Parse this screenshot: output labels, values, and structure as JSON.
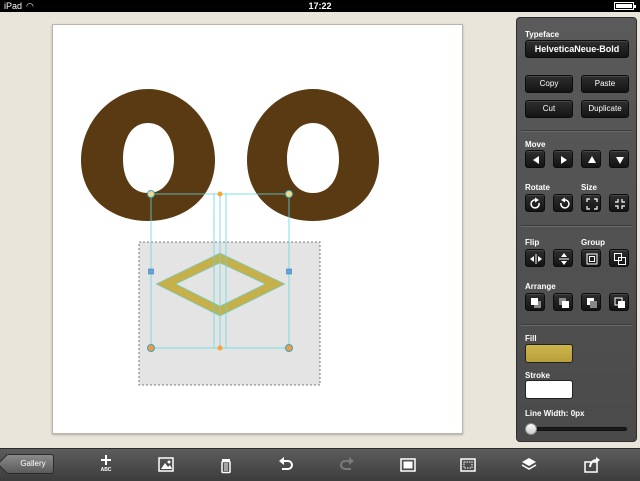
{
  "status_bar": {
    "carrier": "iPad",
    "time": "17:22"
  },
  "canvas": {
    "letters": [
      "O",
      "O"
    ],
    "letter_color": "#5a3a13",
    "shape_fill": "#c6b04c",
    "selection_color": "#5fd7e0"
  },
  "panel": {
    "typeface_label": "Typeface",
    "typeface_value": "HelveticaNeue-Bold",
    "copy": "Copy",
    "paste": "Paste",
    "cut": "Cut",
    "duplicate": "Duplicate",
    "move_label": "Move",
    "rotate_label": "Rotate",
    "size_label": "Size",
    "flip_label": "Flip",
    "group_label": "Group",
    "arrange_label": "Arrange",
    "fill_label": "Fill",
    "fill_color": "#cdb54c",
    "stroke_label": "Stroke",
    "stroke_color": "#ffffff",
    "line_width_label": "Line Width: 0px",
    "line_width_value": 0
  },
  "toolbar": {
    "gallery": "Gallery",
    "abc": "ABC",
    "icons": [
      "add-text-icon",
      "image-icon",
      "trash-icon",
      "undo-icon",
      "redo-icon",
      "frame-icon",
      "fit-frame-icon",
      "layers-icon",
      "share-icon"
    ]
  }
}
